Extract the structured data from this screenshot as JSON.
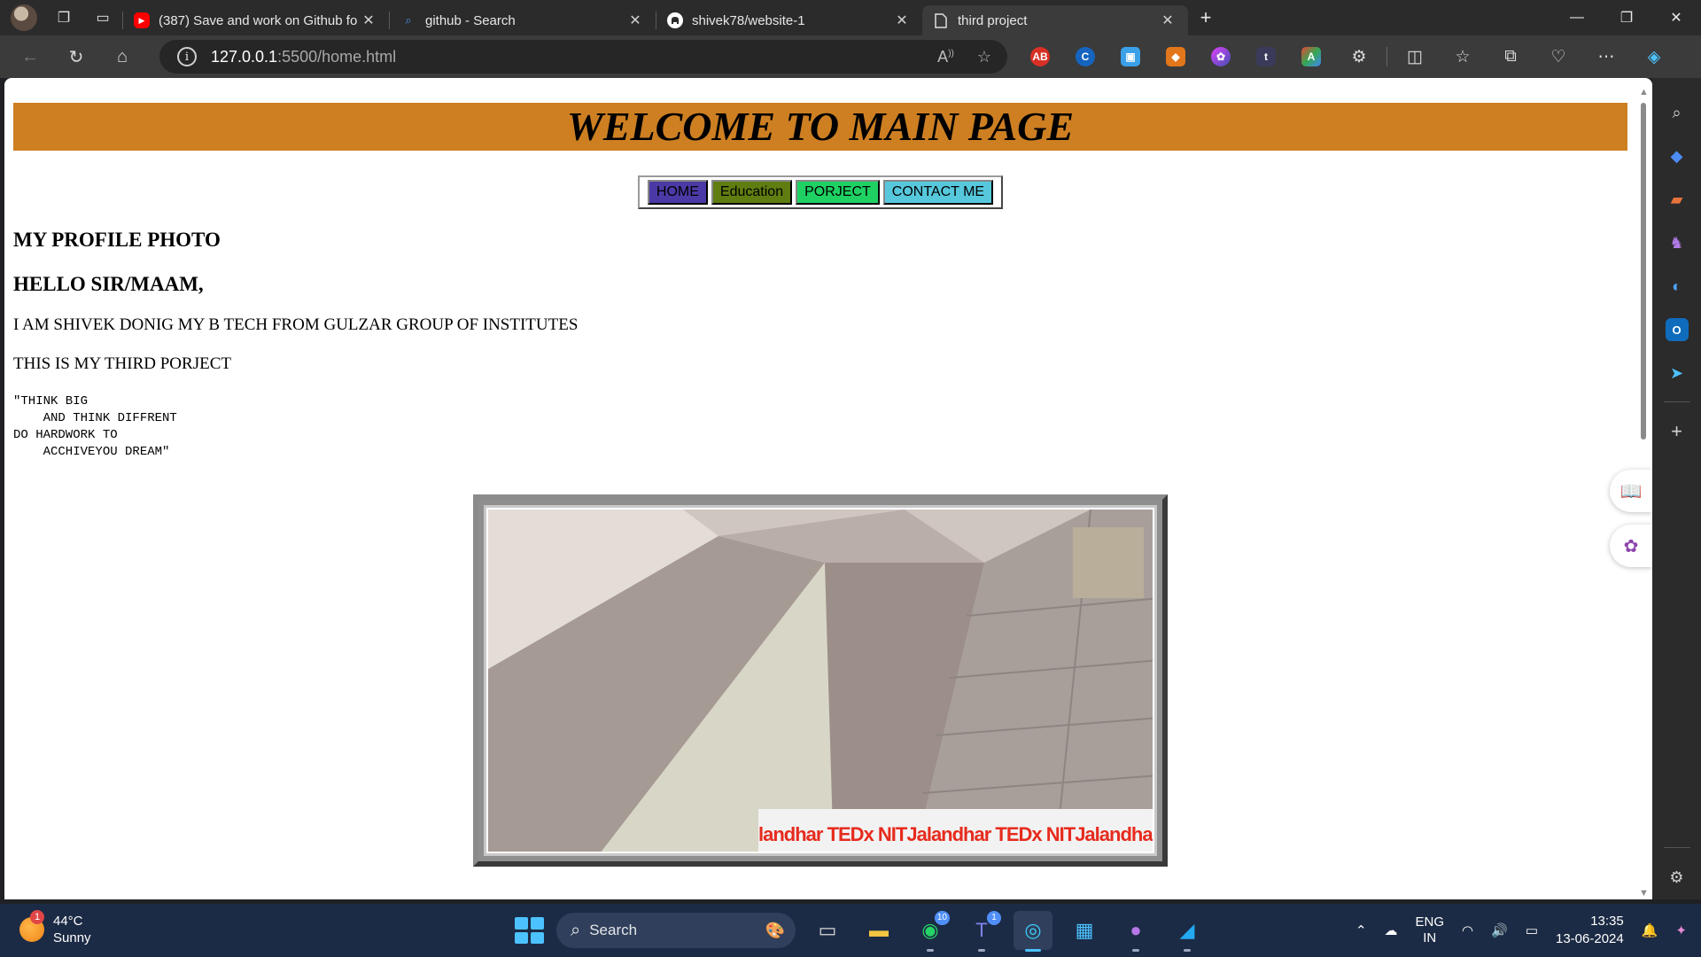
{
  "browser": {
    "tabs": [
      {
        "title": "(387) Save and work on Github fo",
        "icon": "youtube-icon",
        "active": false
      },
      {
        "title": "github - Search",
        "icon": "search-icon",
        "active": false
      },
      {
        "title": "shivek78/website-1",
        "icon": "github-icon",
        "active": false
      },
      {
        "title": "third project",
        "icon": "page-icon",
        "active": true
      }
    ],
    "address": {
      "host": "127.0.0.1",
      "path": ":5500/home.html"
    }
  },
  "page": {
    "banner": "WELCOME TO MAIN PAGE",
    "menu": [
      {
        "label": "HOME",
        "color": "#4b3aa6"
      },
      {
        "label": "Education",
        "color": "#5f7d10"
      },
      {
        "label": "PORJECT",
        "color": "#1fd163"
      },
      {
        "label": "CONTACT ME",
        "color": "#57c8dc"
      }
    ],
    "profile_heading": "MY PROFILE PHOTO",
    "hello_heading": "HELLO SIR/MAAM,",
    "intro": "I AM SHIVEK DONIG MY B TECH FROM GULZAR GROUP OF INSTITUTES",
    "project_line": "THIS IS MY THIRD PORJECT",
    "quote": "\"THINK BIG\n    AND THINK DIFFRENT\nDO HARDWORK TO\n    ACCHIVEYOU DREAM\"",
    "photo_banner_text": "landhar TEDx NITJalandhar TEDx NITJalandhar TEDx NITJa"
  },
  "taskbar": {
    "weather": {
      "temp": "44°C",
      "condition": "Sunny",
      "badge": "1"
    },
    "search_label": "Search",
    "whatsapp_badge": "10",
    "teams_badge": "1",
    "language": {
      "line1": "ENG",
      "line2": "IN"
    },
    "time": "13:35",
    "date": "13-06-2024"
  }
}
